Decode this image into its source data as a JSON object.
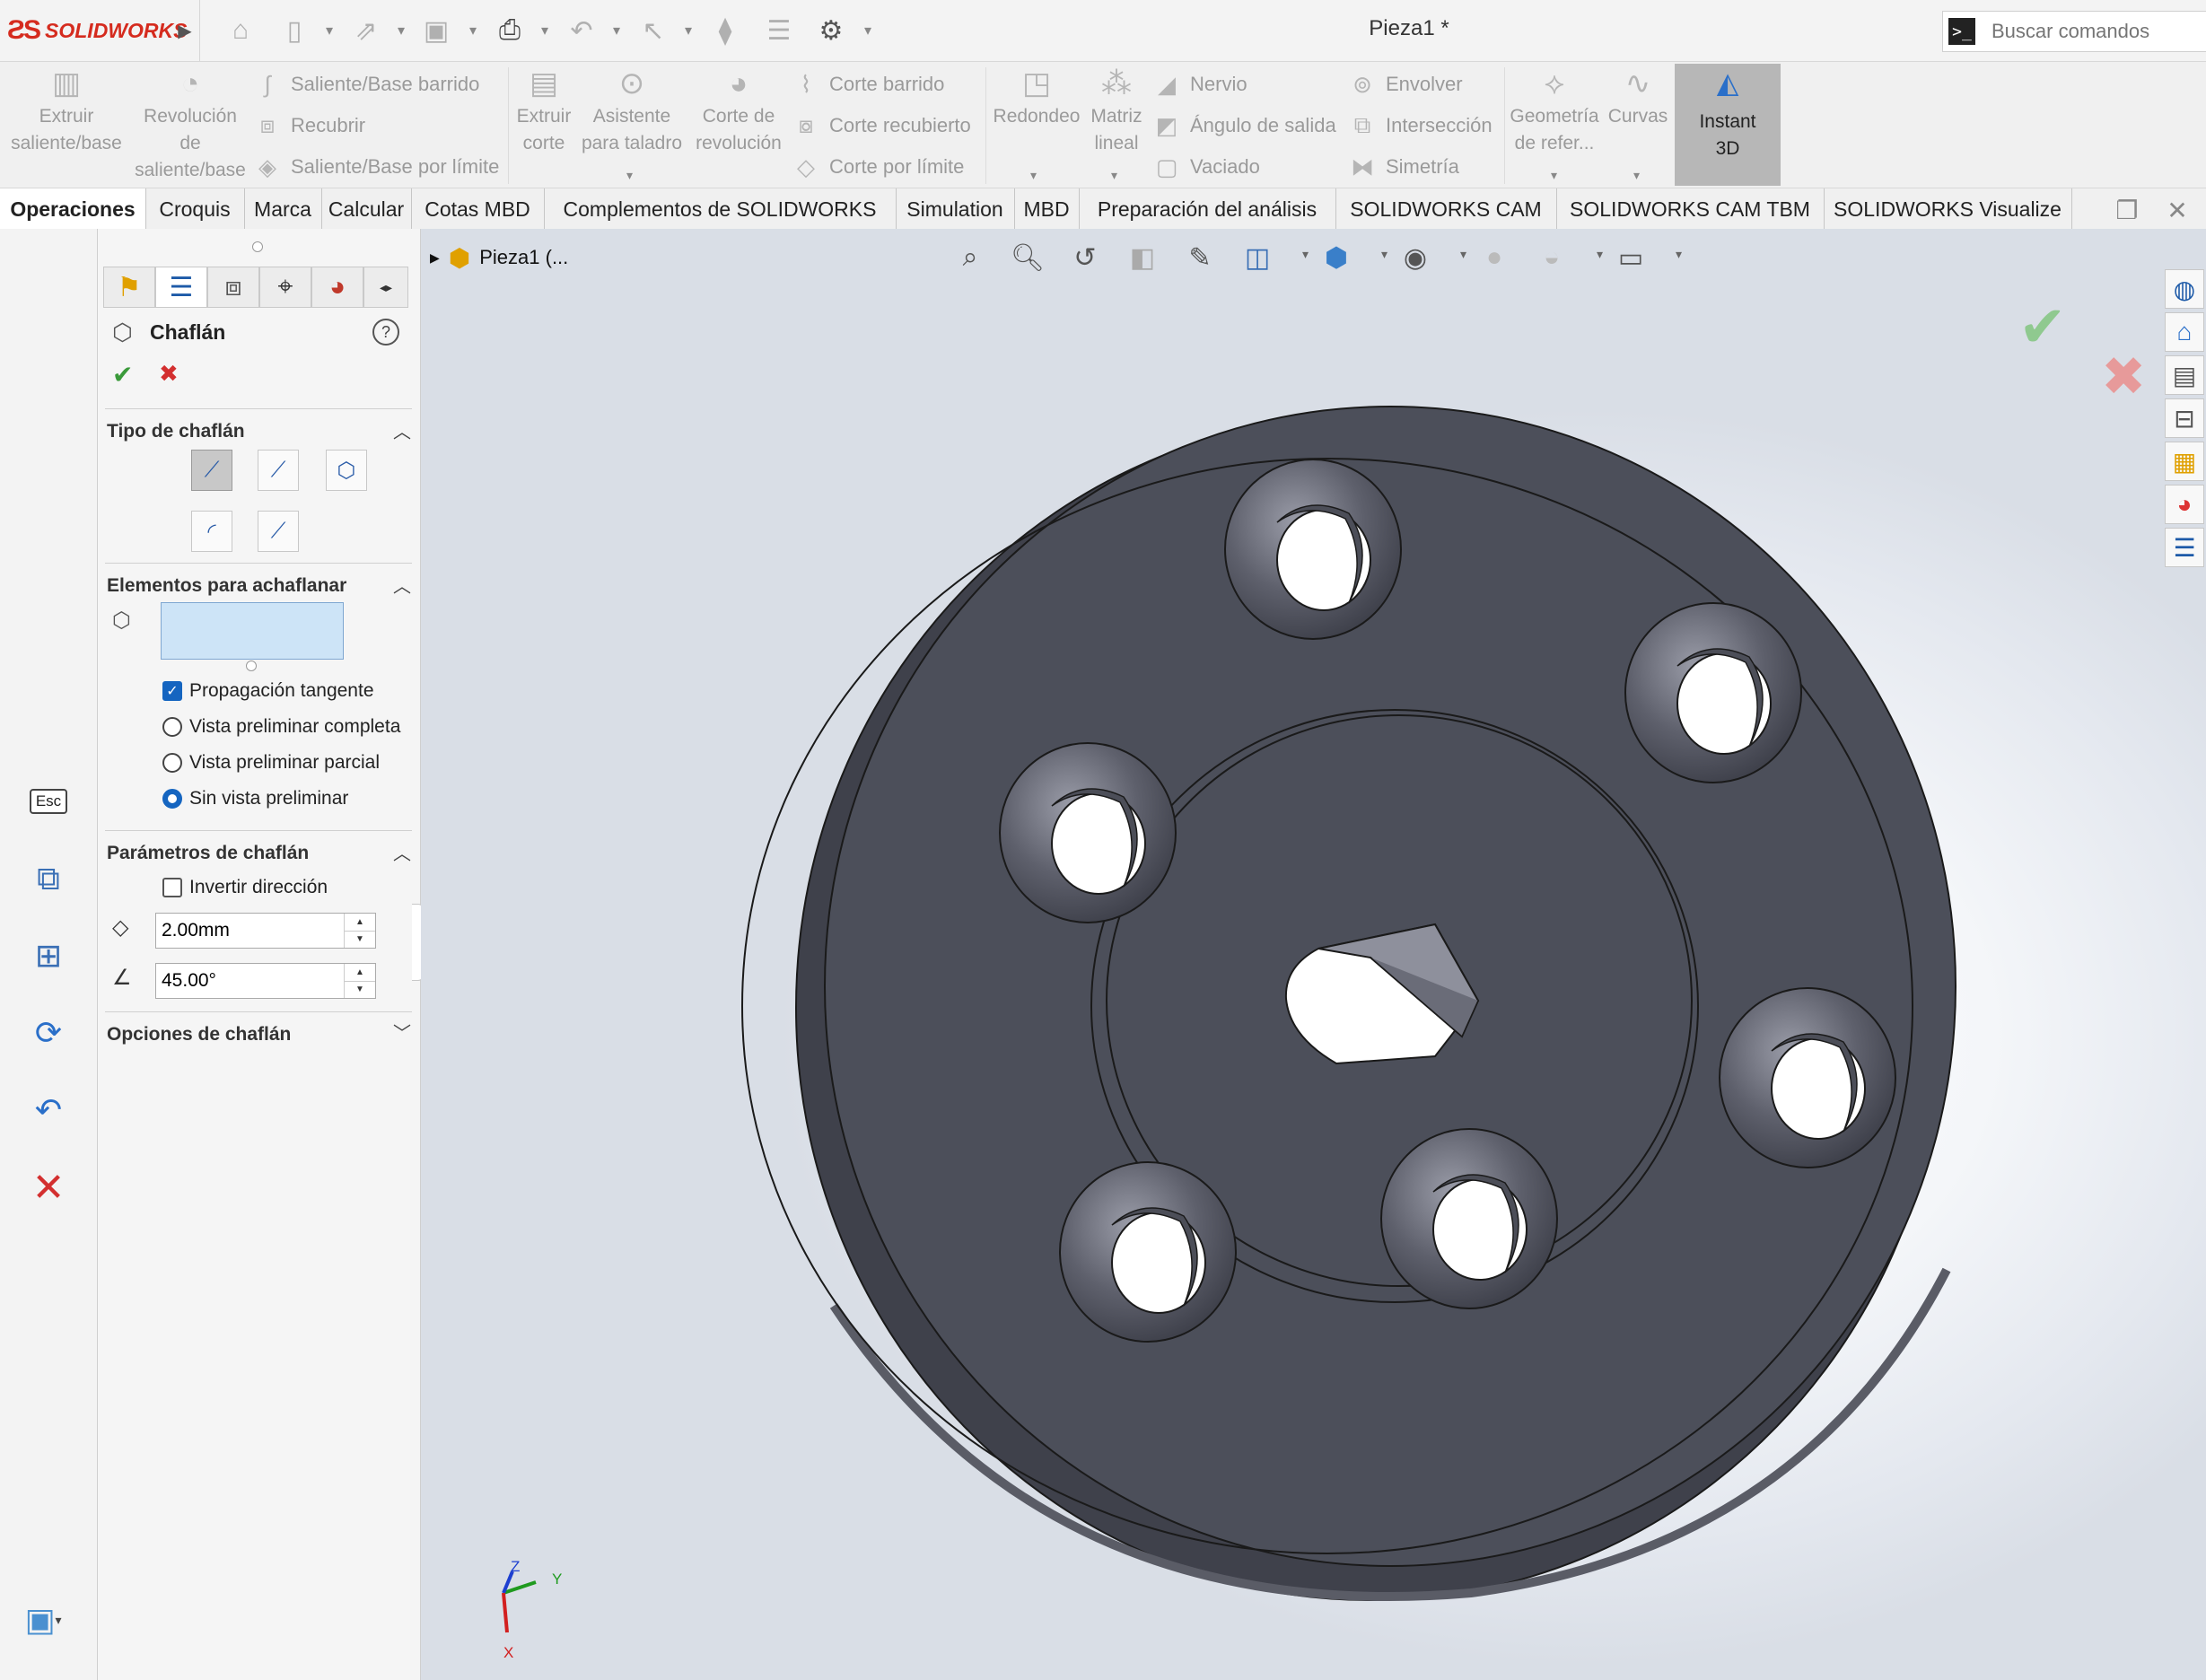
{
  "app": {
    "brand": "SOLIDWORKS",
    "document_title": "Pieza1 *"
  },
  "search": {
    "placeholder": "Buscar comandos"
  },
  "quick_access": [
    "home-icon",
    "new-document-icon",
    "open-icon",
    "save-icon",
    "print-icon",
    "undo-icon",
    "select-icon",
    "rebuild-icon",
    "file-properties-icon",
    "options-icon"
  ],
  "ribbon": {
    "extrude_boss": "Extruir saliente/base",
    "revolve_boss": "Revolución de saliente/base",
    "swept_boss": "Saliente/Base barrido",
    "loft_boss": "Recubrir",
    "boundary_boss": "Saliente/Base por límite",
    "extrude_cut": "Extruir corte",
    "hole_wizard": "Asistente para taladro",
    "revolve_cut": "Corte de revolución",
    "swept_cut": "Corte barrido",
    "loft_cut": "Corte recubierto",
    "boundary_cut": "Corte por límite",
    "fillet": "Redondeo",
    "linear_pattern": "Matriz lineal",
    "rib": "Nervio",
    "draft": "Ángulo de salida",
    "shell": "Vaciado",
    "wrap": "Envolver",
    "intersect": "Intersección",
    "mirror": "Simetría",
    "ref_geometry": "Geometría de refer...",
    "curves": "Curvas",
    "instant3d": "Instant 3D"
  },
  "tabs": [
    "Operaciones",
    "Croquis",
    "Marca",
    "Calcular",
    "Cotas MBD",
    "Complementos de SOLIDWORKS",
    "Simulation",
    "MBD",
    "Preparación del análisis",
    "SOLIDWORKS CAM",
    "SOLIDWORKS CAM TBM",
    "SOLIDWORKS Visualize"
  ],
  "left_tools": {
    "esc": "Esc"
  },
  "property_manager": {
    "title": "Chaflán",
    "sections": {
      "type": "Tipo de chaflán",
      "items": "Elementos para achaflanar",
      "params": "Parámetros de chaflán",
      "options": "Opciones de chaflán"
    },
    "options": {
      "tangent_propagation": "Propagación tangente",
      "full_preview": "Vista preliminar completa",
      "partial_preview": "Vista preliminar parcial",
      "no_preview": "Sin vista preliminar",
      "reverse_direction": "Invertir dirección"
    },
    "distance": "2.00mm",
    "angle": "45.00°"
  },
  "viewport": {
    "tree_root": "Pieza1 (...",
    "triad": {
      "x": "X",
      "y": "Y",
      "z": "Z"
    },
    "part_color": "#4c4f5a"
  }
}
